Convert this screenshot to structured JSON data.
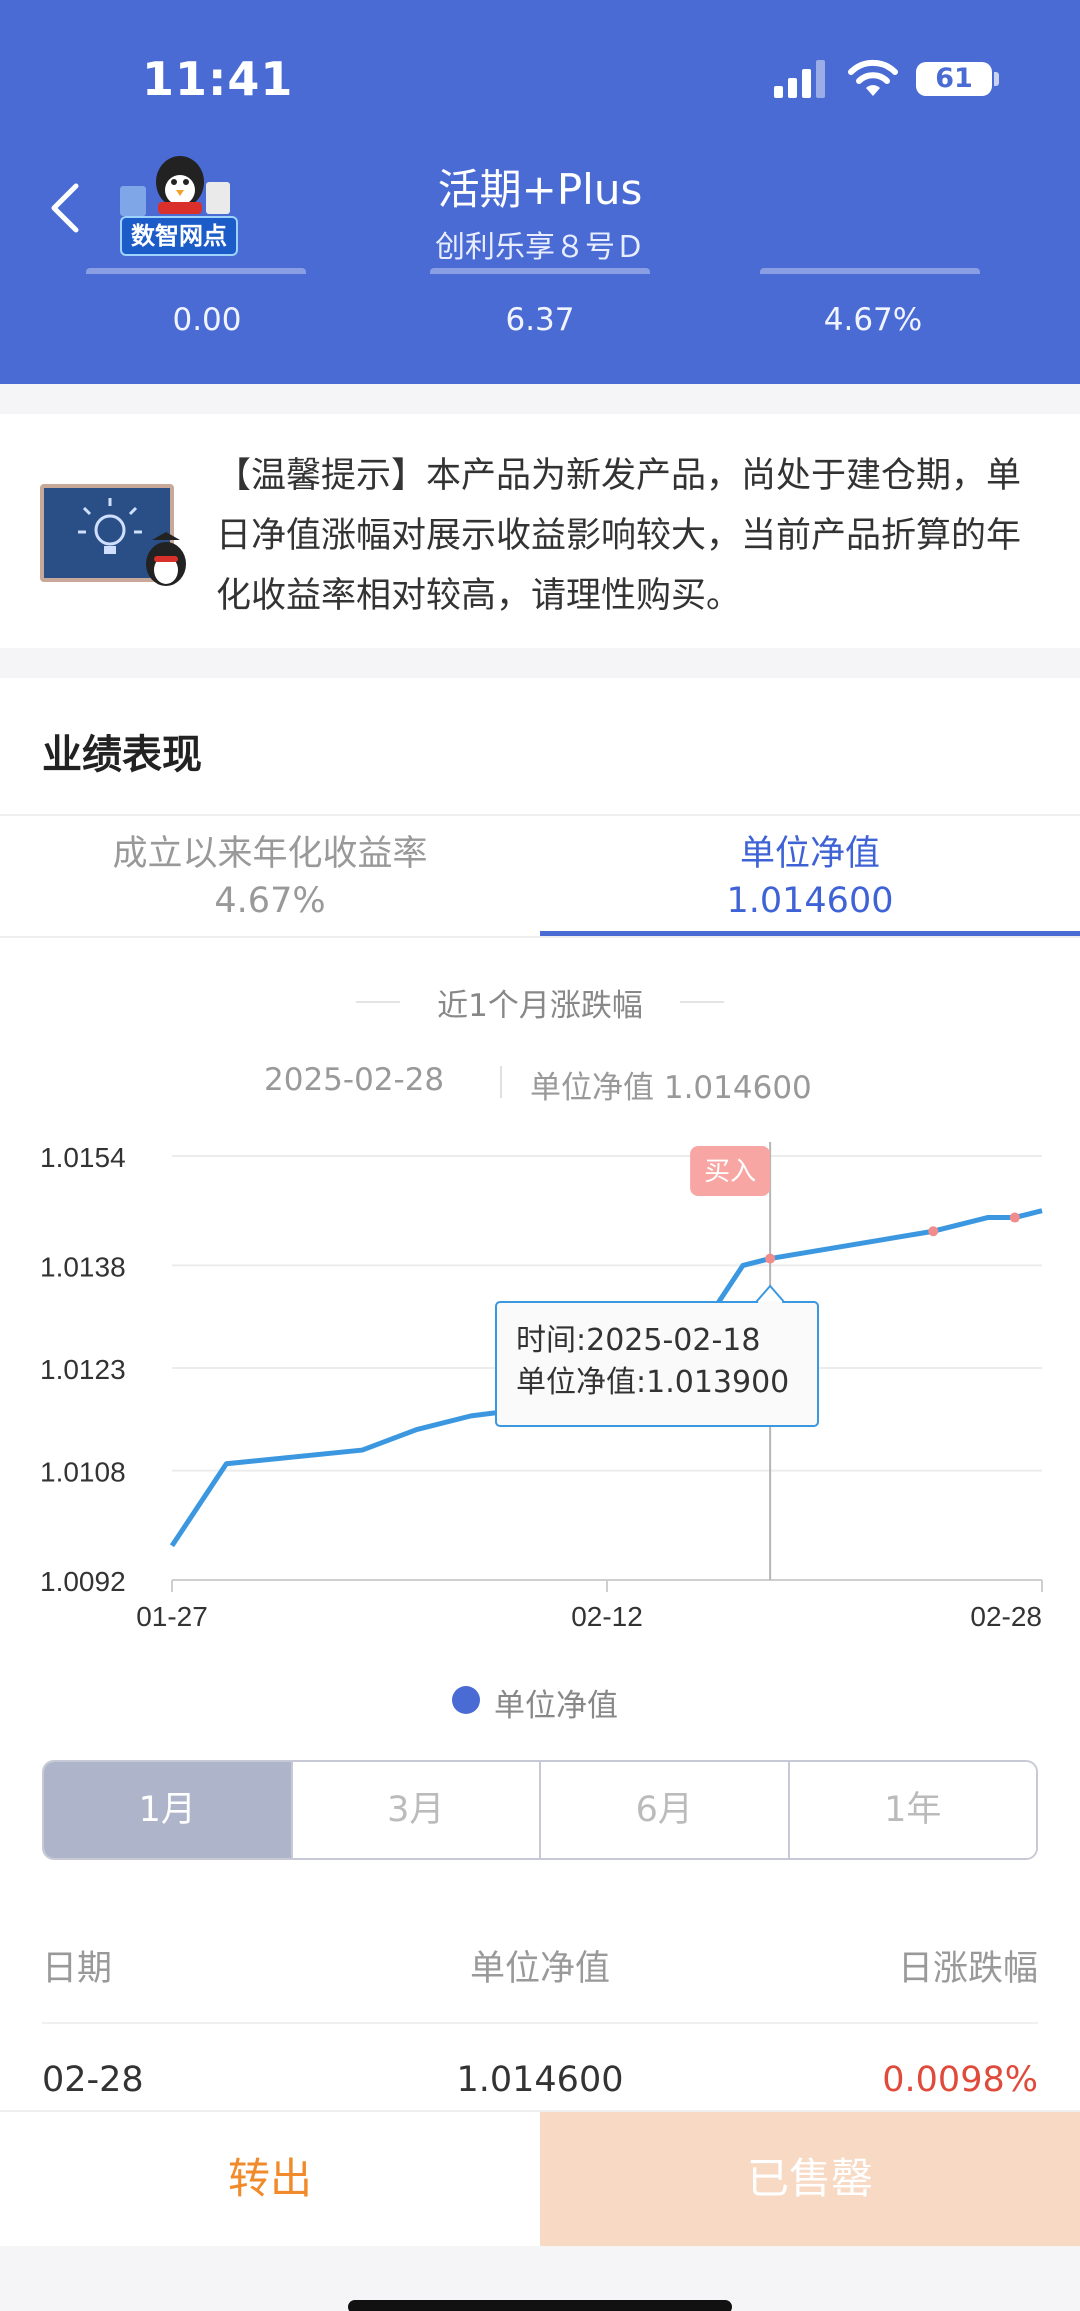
{
  "status": {
    "time": "11:41",
    "battery": "61"
  },
  "nav": {
    "logo_text": "数智网点",
    "title": "活期+Plus",
    "subtitle": "创利乐享８号Ｄ"
  },
  "stats": [
    "0.00",
    "6.37",
    "4.67%"
  ],
  "tip": {
    "text": "【温馨提示】本产品为新发产品，尚处于建仓期，单日净值涨幅对展示收益影响较大，当前产品折算的年化收益率相对较高，请理性购买。"
  },
  "performance": {
    "title": "业绩表现",
    "tabs": [
      {
        "label": "成立以来年化收益率",
        "value": "4.67%"
      },
      {
        "label": "单位净值",
        "value": "1.014600"
      }
    ],
    "caption": "近1个月涨跌幅",
    "latest_date": "2025-02-28",
    "latest_nav_text": "单位净值 1.014600"
  },
  "chart_data": {
    "type": "line",
    "series": [
      {
        "name": "单位净值",
        "x": [
          "01-27",
          "01-29",
          "02-03",
          "02-05",
          "02-07",
          "02-11",
          "02-12",
          "02-14",
          "02-17",
          "02-18",
          "02-24",
          "02-26",
          "02-27",
          "02-28"
        ],
        "values": [
          1.0097,
          1.0109,
          1.0111,
          1.0114,
          1.0116,
          1.0118,
          1.0119,
          1.012,
          1.0138,
          1.0139,
          1.0143,
          1.0145,
          1.0145,
          1.0146
        ]
      }
    ],
    "x_ticks": [
      "01-27",
      "02-12",
      "02-28"
    ],
    "y_ticks": [
      "1.0154",
      "1.0138",
      "1.0123",
      "1.0108",
      "1.0092"
    ],
    "ylim": [
      1.0092,
      1.0154
    ],
    "grid": true,
    "marker_label": "买入",
    "marker_x": "02-18",
    "tooltip": {
      "time": "时间:2025-02-18",
      "nav": "单位净值:1.013900"
    },
    "legend": "单位净值",
    "color": "#3b98e0"
  },
  "periods": [
    {
      "label": "1月",
      "active": true
    },
    {
      "label": "3月",
      "active": false
    },
    {
      "label": "6月",
      "active": false
    },
    {
      "label": "1年",
      "active": false
    }
  ],
  "table": {
    "headers": [
      "日期",
      "单位净值",
      "日涨跌幅"
    ],
    "rows": [
      {
        "date": "02-28",
        "nav": "1.014600",
        "change": "0.0098%"
      }
    ]
  },
  "actions": {
    "transfer_out": "转出",
    "sold_out": "已售罄"
  },
  "colors": {
    "brand": "#4a6bd4",
    "positive": "#e04a3a",
    "action": "#f08a2a"
  }
}
